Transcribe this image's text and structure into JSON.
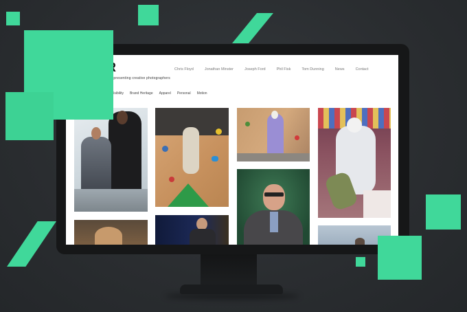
{
  "site": {
    "tagline": "g representing creative photographers",
    "nav": [
      "Chris Floyd",
      "Jonathan Minster",
      "Joseph Ford",
      "Phil Fisk",
      "Tom Dunning",
      "News",
      "Contact"
    ],
    "filters": [
      "Visibility",
      "Brand Heritage",
      "Apparel",
      "Personal",
      "Motion"
    ]
  },
  "colors": {
    "accent": "#40d89a",
    "background": "#2a2d30",
    "monitor": "#161718"
  }
}
